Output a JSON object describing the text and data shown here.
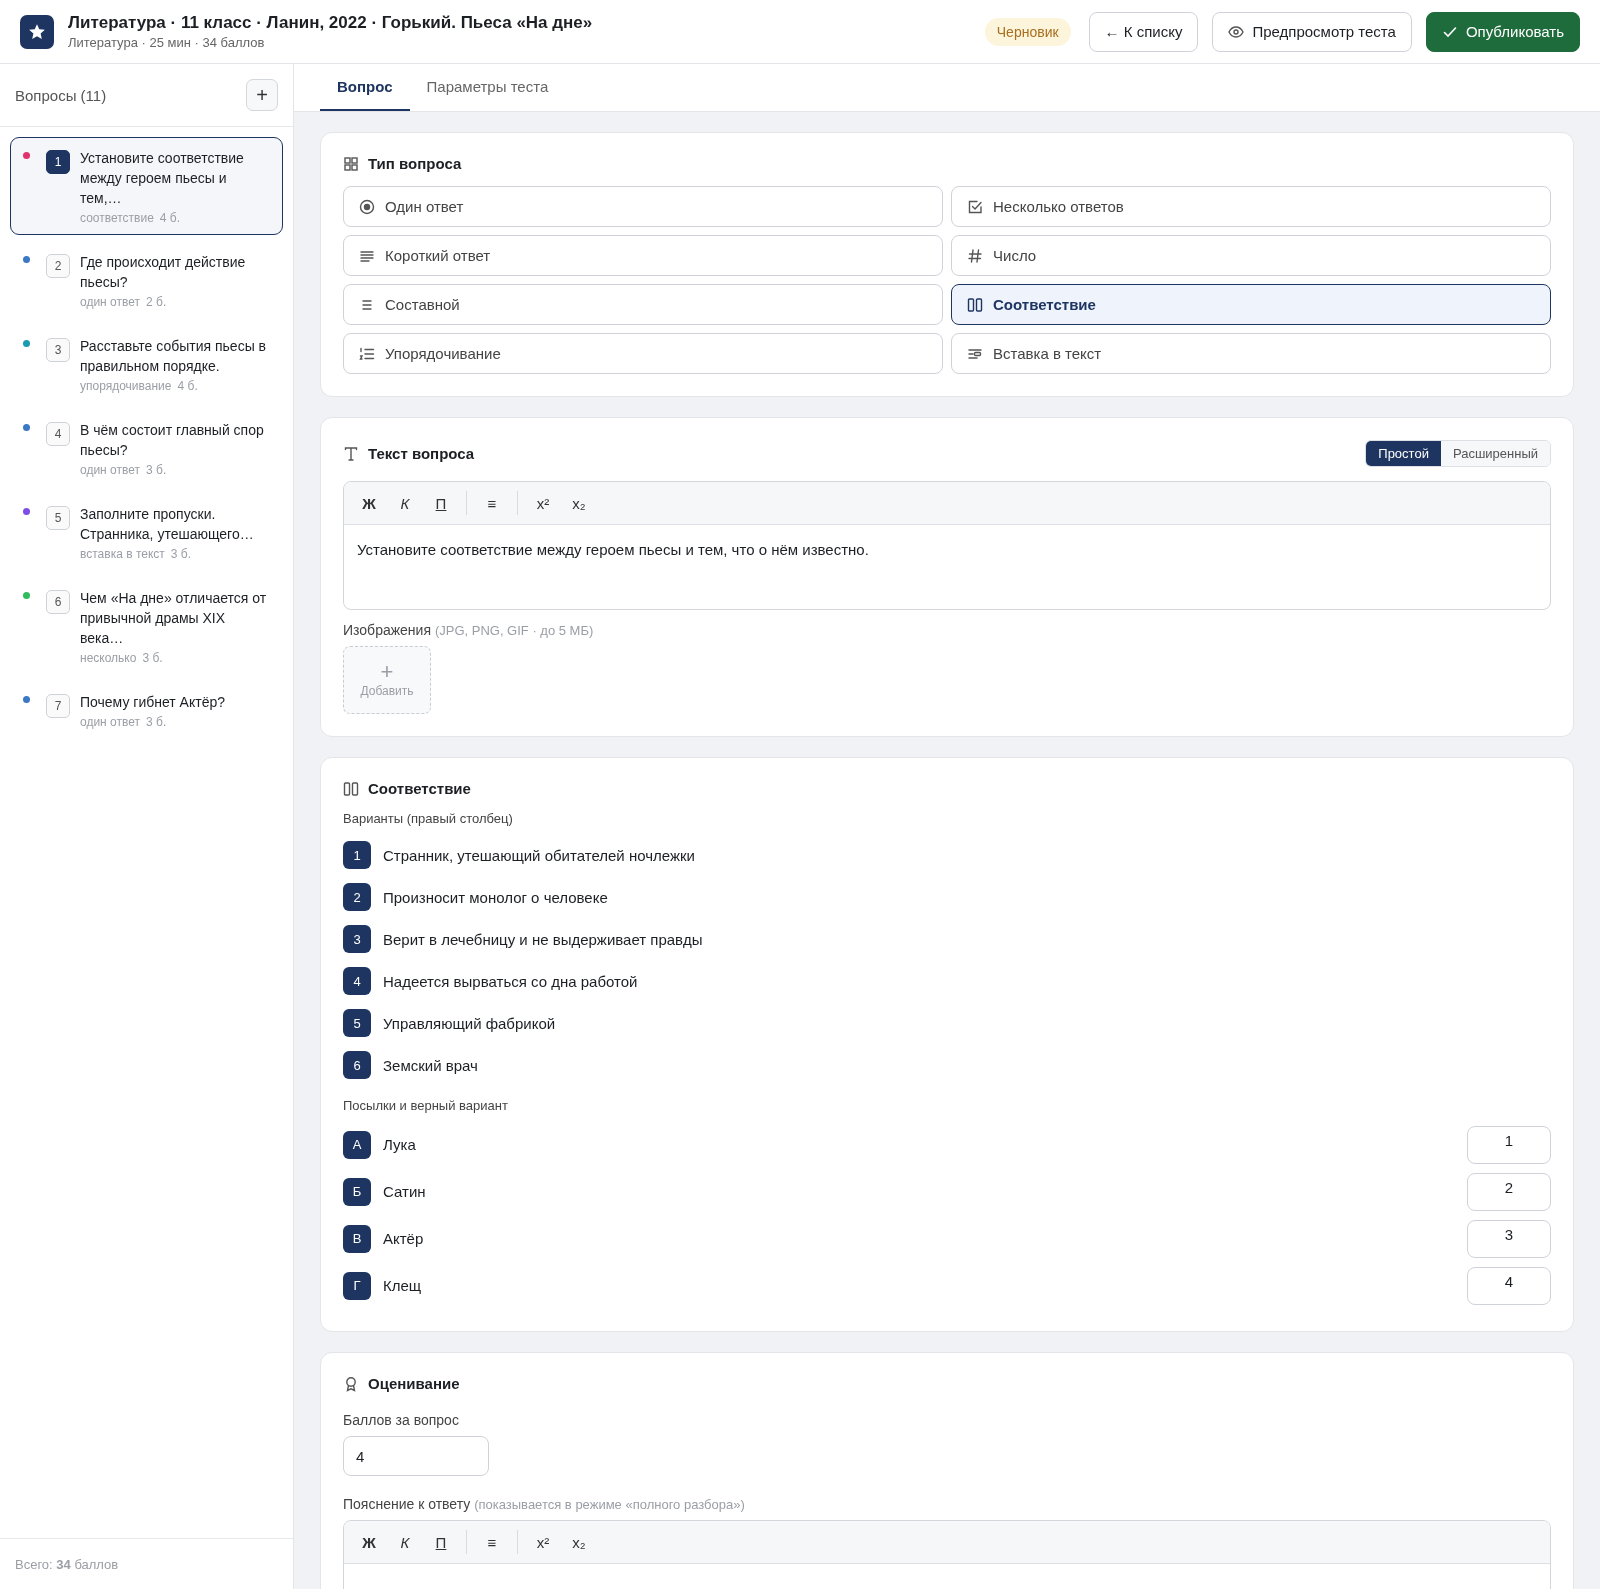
{
  "header": {
    "title": "Литература · 11 класс · Ланин, 2022 · Горький. Пьеса «На дне»",
    "subtitle": "Литература · 25 мин · 34 баллов",
    "status": "Черновик",
    "buttons": [
      {
        "label": "← К списку",
        "kind": "back"
      },
      {
        "label": "Предпросмотр теста",
        "kind": "preview"
      },
      {
        "label": "Опубликовать",
        "kind": "publish"
      }
    ]
  },
  "sidebar": {
    "title": "Вопросы (11)",
    "add_button": "+",
    "total": "Всего: **34** баллов",
    "questions": [
      {
        "number": "1",
        "text": "Установите соответствие между героем пьесы и тем,…",
        "type": "соответствие",
        "points": "4 б.",
        "color": "#e0336e",
        "selected": true
      },
      {
        "number": "2",
        "text": "Где происходит действие пьесы?",
        "type": "один ответ",
        "points": "2 б.",
        "color": "#3b78c4",
        "selected": false
      },
      {
        "number": "3",
        "text": "Расставьте события пьесы в правильном порядке.",
        "type": "упорядочивание",
        "points": "4 б.",
        "color": "#1b9ab0",
        "selected": false
      },
      {
        "number": "4",
        "text": "В чём состоит главный спор пьесы?",
        "type": "один ответ",
        "points": "3 б.",
        "color": "#3b78c4",
        "selected": false
      },
      {
        "number": "5",
        "text": "Заполните пропуски. Странника, утешающего…",
        "type": "вставка в текст",
        "points": "3 б.",
        "color": "#7c4de8",
        "selected": false
      },
      {
        "number": "6",
        "text": "Чем «На дне» отличается от привычной драмы XIX века…",
        "type": "несколько",
        "points": "3 б.",
        "color": "#2ebd5a",
        "selected": false
      },
      {
        "number": "7",
        "text": "Почему гибнет Актёр?",
        "type": "один ответ",
        "points": "3 б.",
        "color": "#3b78c4",
        "selected": false
      }
    ]
  },
  "tabs": [
    {
      "label": "Вопрос",
      "selected": true
    },
    {
      "label": "Параметры теста",
      "selected": false
    }
  ],
  "question_type": {
    "title": "Тип вопроса",
    "options": [
      {
        "label": "Один ответ",
        "kind": "single",
        "selected": false
      },
      {
        "label": "Несколько ответов",
        "kind": "multiple",
        "selected": false
      },
      {
        "label": "Короткий ответ",
        "kind": "short",
        "selected": false
      },
      {
        "label": "Число",
        "kind": "number",
        "selected": false
      },
      {
        "label": "Составной",
        "kind": "composite",
        "selected": false
      },
      {
        "label": "Соответствие",
        "kind": "matching",
        "selected": true
      },
      {
        "label": "Упорядочивание",
        "kind": "ordering",
        "selected": false
      },
      {
        "label": "Вставка в текст",
        "kind": "insert",
        "selected": false
      }
    ]
  },
  "question_text": {
    "title": "Текст вопроса",
    "modes": [
      {
        "label": "Простой",
        "selected": true
      },
      {
        "label": "Расширенный",
        "selected": false
      }
    ],
    "toolbar": [
      {
        "label": "Ж",
        "kind": "bold"
      },
      {
        "label": "К",
        "kind": "italic"
      },
      {
        "label": "П",
        "kind": "underline"
      },
      {
        "label": "≡",
        "kind": "list"
      },
      {
        "label": "x²",
        "kind": "sup"
      },
      {
        "label": "x₂",
        "kind": "sub"
      }
    ],
    "value": "Установите соответствие между героем пьесы и тем, что о нём известно.",
    "images_label": "Изображения",
    "images_hint": "(JPG, PNG, GIF · до 5 МБ)",
    "add_icon": "+",
    "add_label": "Добавить"
  },
  "matching": {
    "title": "Соответствие",
    "options_label": "Варианты (правый столбец)",
    "options": [
      {
        "marker": "1",
        "text": "Странник, утешающий обитателей ночлежки"
      },
      {
        "marker": "2",
        "text": "Произносит монолог о человеке"
      },
      {
        "marker": "3",
        "text": "Верит в лечебницу и не выдерживает правды"
      },
      {
        "marker": "4",
        "text": "Надеется вырваться со дна работой"
      },
      {
        "marker": "5",
        "text": "Управляющий фабрикой"
      },
      {
        "marker": "6",
        "text": "Земский врач"
      }
    ],
    "premises_label": "Посылки и верный вариант",
    "premises": [
      {
        "marker": "А",
        "text": "Лука",
        "answer": "1"
      },
      {
        "marker": "Б",
        "text": "Сатин",
        "answer": "2"
      },
      {
        "marker": "В",
        "text": "Актёр",
        "answer": "3"
      },
      {
        "marker": "Г",
        "text": "Клещ",
        "answer": "4"
      }
    ]
  },
  "grading": {
    "title": "Оценивание",
    "points_label": "Баллов за вопрос",
    "points": "4",
    "explanation_label": "Пояснение к ответу",
    "explanation_hint": "(показывается в режиме «полного разбора»)",
    "toolbar": [
      {
        "label": "Ж",
        "kind": "bold"
      },
      {
        "label": "К",
        "kind": "italic"
      },
      {
        "label": "П",
        "kind": "underline"
      },
      {
        "label": "≡",
        "kind": "list"
      },
      {
        "label": "x²",
        "kind": "sup"
      },
      {
        "label": "x₂",
        "kind": "sub"
      }
    ]
  }
}
